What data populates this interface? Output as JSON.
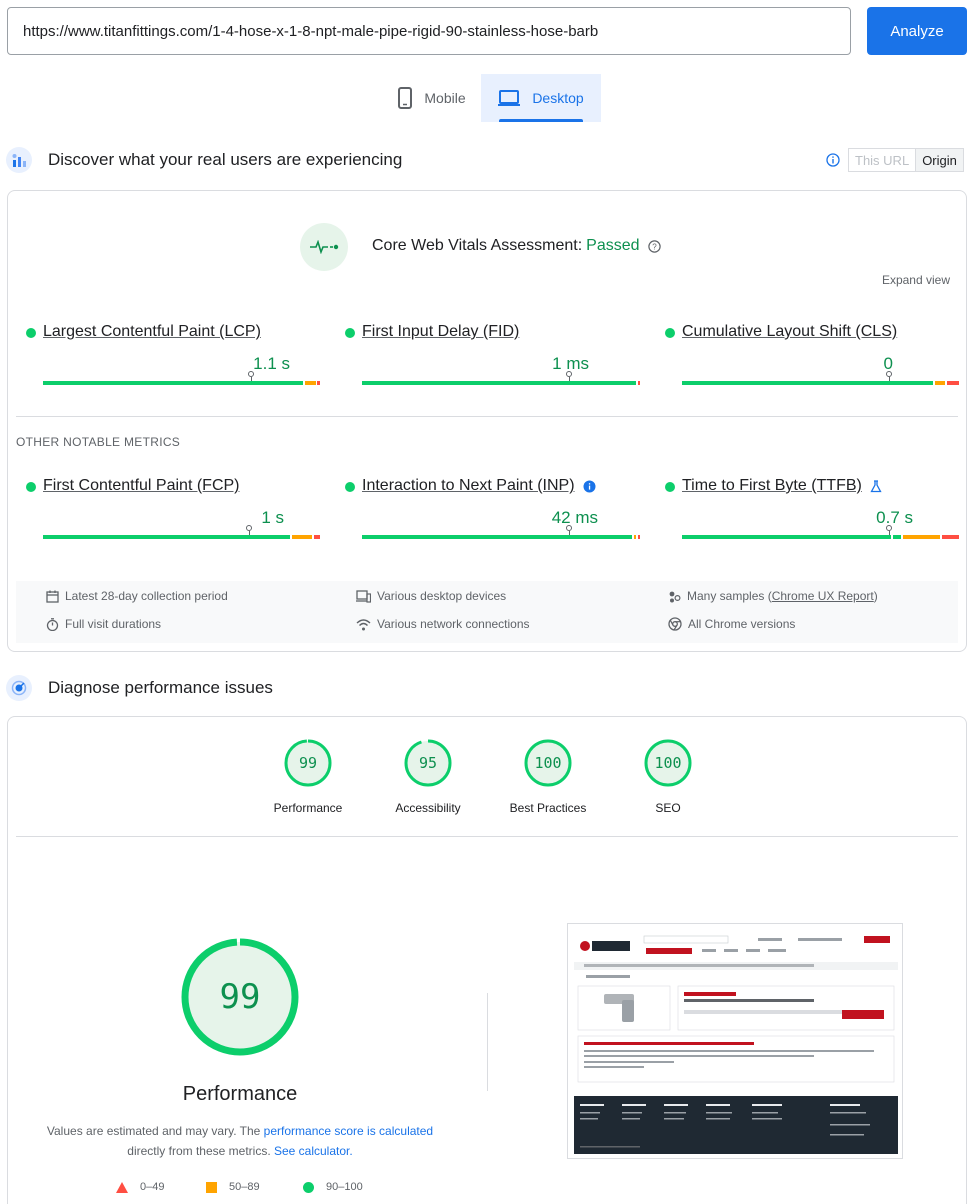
{
  "header": {
    "url_value": "https://www.titanfittings.com/1-4-hose-x-1-8-npt-male-pipe-rigid-90-stainless-hose-barb",
    "analyze_label": "Analyze"
  },
  "tabs": [
    {
      "label": "Mobile",
      "icon": "smartphone-icon",
      "selected": false
    },
    {
      "label": "Desktop",
      "icon": "laptop-icon",
      "selected": true
    }
  ],
  "field_section": {
    "title": "Discover what your real users are experiencing",
    "this_url_label": "This URL",
    "origin_label": "Origin",
    "assessment_prefix": "Core Web Vitals Assessment:",
    "assessment_status": "Passed",
    "expand_label": "Expand view",
    "core_metrics": [
      {
        "name": "Largest Contentful Paint (LCP)",
        "value": "1.1 s",
        "status_color": "#0cce6b"
      },
      {
        "name": "First Input Delay (FID)",
        "value": "1 ms",
        "status_color": "#0cce6b"
      },
      {
        "name": "Cumulative Layout Shift (CLS)",
        "value": "0",
        "status_color": "#0cce6b"
      }
    ],
    "other_label": "OTHER NOTABLE METRICS",
    "other_metrics": [
      {
        "name": "First Contentful Paint (FCP)",
        "value": "1 s",
        "status_color": "#0cce6b"
      },
      {
        "name": "Interaction to Next Paint (INP)",
        "value": "42 ms",
        "status_color": "#0cce6b"
      },
      {
        "name": "Time to First Byte (TTFB)",
        "value": "0.7 s",
        "status_color": "#0cce6b"
      }
    ],
    "info": {
      "period": "Latest 28-day collection period",
      "devices": "Various desktop devices",
      "samples_prefix": "Many samples (",
      "samples_link": "Chrome UX Report",
      "samples_suffix": ")",
      "durations": "Full visit durations",
      "network": "Various network connections",
      "versions": "All Chrome versions"
    }
  },
  "lab_section": {
    "title": "Diagnose performance issues",
    "scores": [
      {
        "label": "Performance",
        "score": "99",
        "fraction": 0.99
      },
      {
        "label": "Accessibility",
        "score": "95",
        "fraction": 0.95
      },
      {
        "label": "Best Practices",
        "score": "100",
        "fraction": 1.0
      },
      {
        "label": "SEO",
        "score": "100",
        "fraction": 1.0
      }
    ],
    "main_score": "99",
    "main_fraction": 0.99,
    "main_label": "Performance",
    "note_prefix": "Values are estimated and may vary. The ",
    "note_link1": "performance score is calculated",
    "note_middle": " directly from these metrics. ",
    "note_link2": "See calculator.",
    "legend": [
      {
        "range": "0–49",
        "color": "#ff4e42",
        "shape": "triangle"
      },
      {
        "range": "50–89",
        "color": "#ffa400",
        "shape": "square"
      },
      {
        "range": "90–100",
        "color": "#0cce6b",
        "shape": "circle"
      }
    ]
  },
  "colors": {
    "accent": "#1a73e8",
    "good": "#0cce6b",
    "average": "#ffa400",
    "poor": "#ff4e42"
  }
}
